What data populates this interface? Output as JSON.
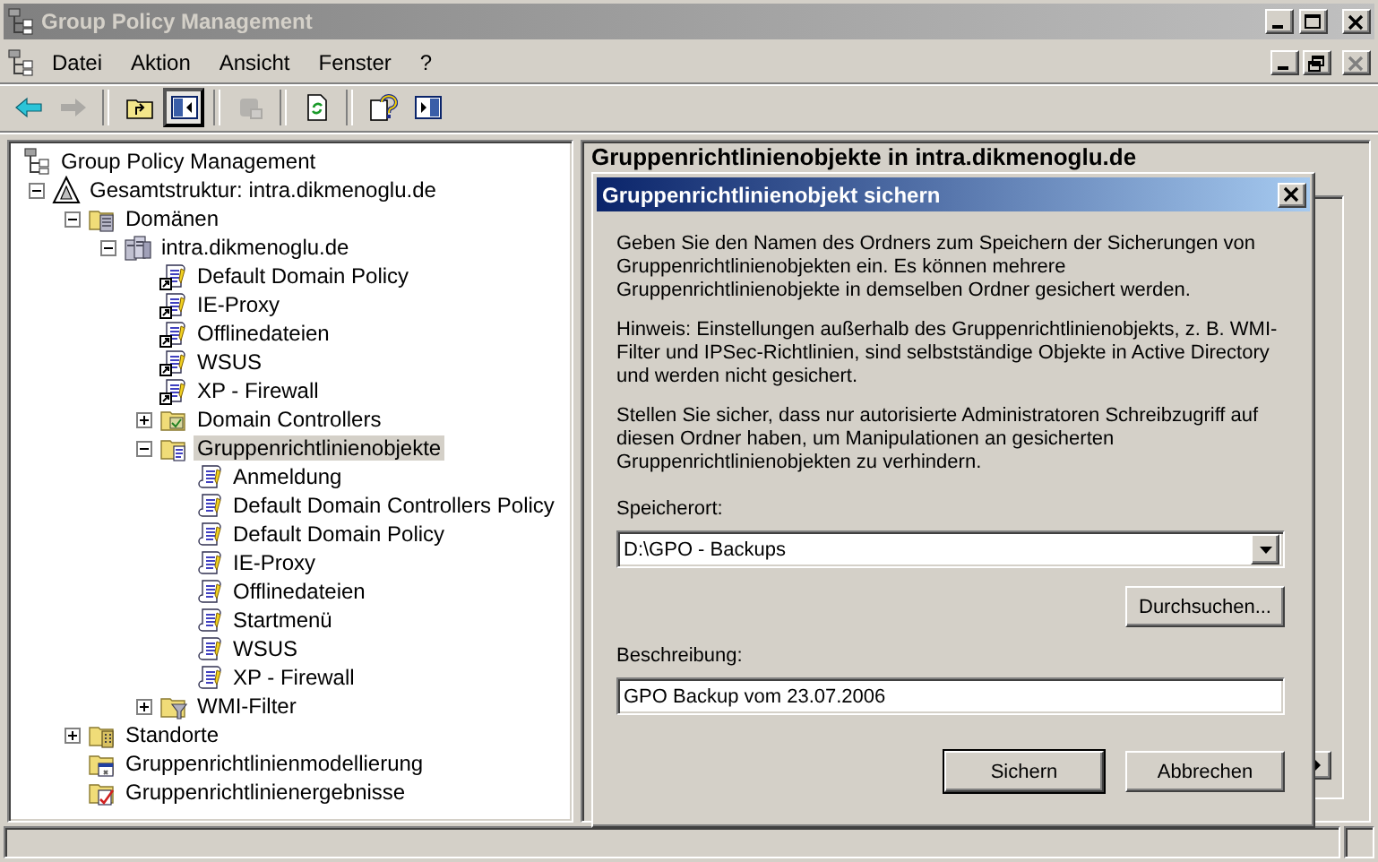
{
  "window": {
    "title": "Group Policy Management",
    "active": false
  },
  "menu": [
    {
      "label": "Datei"
    },
    {
      "label": "Aktion"
    },
    {
      "label": "Ansicht"
    },
    {
      "label": "Fenster"
    },
    {
      "label": "?"
    }
  ],
  "toolbar": [
    {
      "kind": "back",
      "disabled": false,
      "pressed": false
    },
    {
      "kind": "forward",
      "disabled": true,
      "pressed": false
    },
    {
      "kind": "separator"
    },
    {
      "kind": "up",
      "disabled": false,
      "pressed": false
    },
    {
      "kind": "tree",
      "disabled": false,
      "pressed": true
    },
    {
      "kind": "separator"
    },
    {
      "kind": "delete",
      "disabled": true,
      "pressed": false
    },
    {
      "kind": "separator"
    },
    {
      "kind": "refresh",
      "disabled": false,
      "pressed": false
    },
    {
      "kind": "separator"
    },
    {
      "kind": "help",
      "disabled": false,
      "pressed": false
    },
    {
      "kind": "console",
      "disabled": false,
      "pressed": false
    }
  ],
  "tree": {
    "label": "Group Policy Management",
    "kind": "root",
    "selected": false,
    "children": [
      {
        "label": "Gesamtstruktur: intra.dikmenoglu.de",
        "kind": "forest",
        "selected": false,
        "expanded": true,
        "children": [
          {
            "label": "Domänen",
            "kind": "domains",
            "selected": false,
            "expanded": true,
            "children": [
              {
                "label": "intra.dikmenoglu.de",
                "kind": "domain",
                "selected": false,
                "expanded": true,
                "children": [
                  {
                    "label": "Default Domain Policy",
                    "kind": "gpo-link",
                    "selected": false
                  },
                  {
                    "label": "IE-Proxy",
                    "kind": "gpo-link",
                    "selected": false
                  },
                  {
                    "label": "Offlinedateien",
                    "kind": "gpo-link",
                    "selected": false
                  },
                  {
                    "label": "WSUS",
                    "kind": "gpo-link",
                    "selected": false
                  },
                  {
                    "label": "XP - Firewall",
                    "kind": "gpo-link",
                    "selected": false
                  },
                  {
                    "label": "Domain Controllers",
                    "kind": "ou",
                    "selected": false,
                    "expanded": false
                  },
                  {
                    "label": "Gruppenrichtlinienobjekte",
                    "kind": "gpo-folder",
                    "selected": true,
                    "expanded": true,
                    "children": [
                      {
                        "label": "Anmeldung",
                        "kind": "gpo",
                        "selected": false
                      },
                      {
                        "label": "Default Domain Controllers Policy",
                        "kind": "gpo",
                        "selected": false
                      },
                      {
                        "label": "Default Domain Policy",
                        "kind": "gpo",
                        "selected": false
                      },
                      {
                        "label": "IE-Proxy",
                        "kind": "gpo",
                        "selected": false
                      },
                      {
                        "label": "Offlinedateien",
                        "kind": "gpo",
                        "selected": false
                      },
                      {
                        "label": "Startmenü",
                        "kind": "gpo",
                        "selected": false
                      },
                      {
                        "label": "WSUS",
                        "kind": "gpo",
                        "selected": false
                      },
                      {
                        "label": "XP - Firewall",
                        "kind": "gpo",
                        "selected": false
                      }
                    ]
                  },
                  {
                    "label": "WMI-Filter",
                    "kind": "wmi",
                    "selected": false,
                    "expanded": false
                  }
                ]
              }
            ]
          },
          {
            "label": "Standorte",
            "kind": "sites",
            "selected": false,
            "expanded": false
          },
          {
            "label": "Gruppenrichtlinienmodellierung",
            "kind": "modeling",
            "selected": false
          },
          {
            "label": "Gruppenrichtlinienergebnisse",
            "kind": "results",
            "selected": false
          }
        ]
      }
    ]
  },
  "details": {
    "title": "Gruppenrichtlinienobjekte in intra.dikmenoglu.de"
  },
  "dialog": {
    "title": "Gruppenrichtlinienobjekt sichern",
    "active": true,
    "paragraphs": [
      "Geben Sie den Namen des Ordners zum Speichern der Sicherungen von Gruppenrichtlinienobjekten ein. Es können mehrere Gruppenrichtlinienobjekte in demselben Ordner gesichert werden.",
      "Hinweis: Einstellungen außerhalb des Gruppenrichtlinienobjekts, z. B. WMI-Filter und IPSec-Richtlinien, sind selbstständige Objekte in Active Directory und werden nicht gesichert.",
      "Stellen Sie sicher, dass nur autorisierte Administratoren Schreibzugriff auf diesen Ordner haben, um Manipulationen an gesicherten Gruppenrichtlinienobjekten zu verhindern."
    ],
    "location": {
      "label": "Speicherort:",
      "value": "D:\\GPO - Backups"
    },
    "browse_button": {
      "label": "Durchsuchen..."
    },
    "description": {
      "label": "Beschreibung:",
      "value": "GPO Backup vom 23.07.2006"
    },
    "buttons": [
      {
        "label": "Sichern",
        "default": true
      },
      {
        "label": "Abbrechen",
        "default": false
      }
    ]
  }
}
